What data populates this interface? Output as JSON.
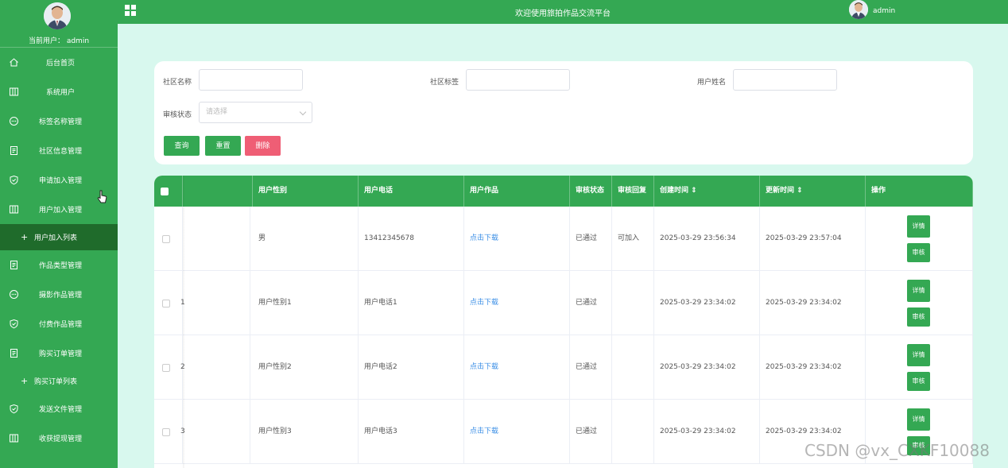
{
  "sidebar": {
    "current_user": "当前用户：  admin",
    "items": [
      {
        "label": "后台首页",
        "icon": "home-icon"
      },
      {
        "label": "系统用户",
        "icon": "columns-icon"
      },
      {
        "label": "标签名称管理",
        "icon": "chat-icon"
      },
      {
        "label": "社区信息管理",
        "icon": "document-icon"
      },
      {
        "label": "申请加入管理",
        "icon": "shield-icon"
      },
      {
        "label": "用户加入管理",
        "icon": "columns-icon"
      },
      {
        "label": "作品类型管理",
        "icon": "document-icon"
      },
      {
        "label": "摄影作品管理",
        "icon": "chat-icon"
      },
      {
        "label": "付费作品管理",
        "icon": "shield-icon"
      },
      {
        "label": "购买订单管理",
        "icon": "document-icon"
      },
      {
        "label": "发送文件管理",
        "icon": "shield-icon"
      },
      {
        "label": "收获提现管理",
        "icon": "columns-icon"
      }
    ],
    "sub_items": [
      {
        "label": "用户加入列表",
        "active": true
      },
      {
        "label": "购买订单列表",
        "active": false
      }
    ]
  },
  "header": {
    "title": "欢迎使用旅拍作品交流平台",
    "user": "admin"
  },
  "search": {
    "community_name_label": "社区名称",
    "community_tag_label": "社区标签",
    "user_name_label": "用户姓名",
    "review_status_label": "审核状态",
    "review_status_placeholder": "请选择",
    "query_button": "查询",
    "reset_button": "重置",
    "delete_button": "删除"
  },
  "table": {
    "columns": [
      "用户性别",
      "用户电话",
      "用户作品",
      "审核状态",
      "审核回复",
      "创建时间 ⇕",
      "更新时间 ⇕",
      "操作"
    ],
    "detail_button": "详情",
    "review_button": "审核",
    "rows": [
      {
        "idx": "",
        "gender": "男",
        "phone": "13412345678",
        "work": "点击下载",
        "status": "已通过",
        "reply": "可加入",
        "created": "2025-03-29 23:56:34",
        "updated": "2025-03-29 23:57:04"
      },
      {
        "idx": "1",
        "gender": "用户性别1",
        "phone": "用户电话1",
        "work": "点击下载",
        "status": "已通过",
        "reply": "",
        "created": "2025-03-29 23:34:02",
        "updated": "2025-03-29 23:34:02"
      },
      {
        "idx": "2",
        "gender": "用户性别2",
        "phone": "用户电话2",
        "work": "点击下载",
        "status": "已通过",
        "reply": "",
        "created": "2025-03-29 23:34:02",
        "updated": "2025-03-29 23:34:02"
      },
      {
        "idx": "3",
        "gender": "用户性别3",
        "phone": "用户电话3",
        "work": "点击下载",
        "status": "已通过",
        "reply": "",
        "created": "2025-03-29 23:34:02",
        "updated": "2025-03-29 23:34:02"
      }
    ]
  },
  "watermark": "CSDN @vx_CXKF10088",
  "colors": {
    "primary": "#34a853",
    "active_menu": "#1f6b2b",
    "background": "#d8f8ee",
    "danger": "#ef5e75",
    "link": "#3a8ee6"
  }
}
